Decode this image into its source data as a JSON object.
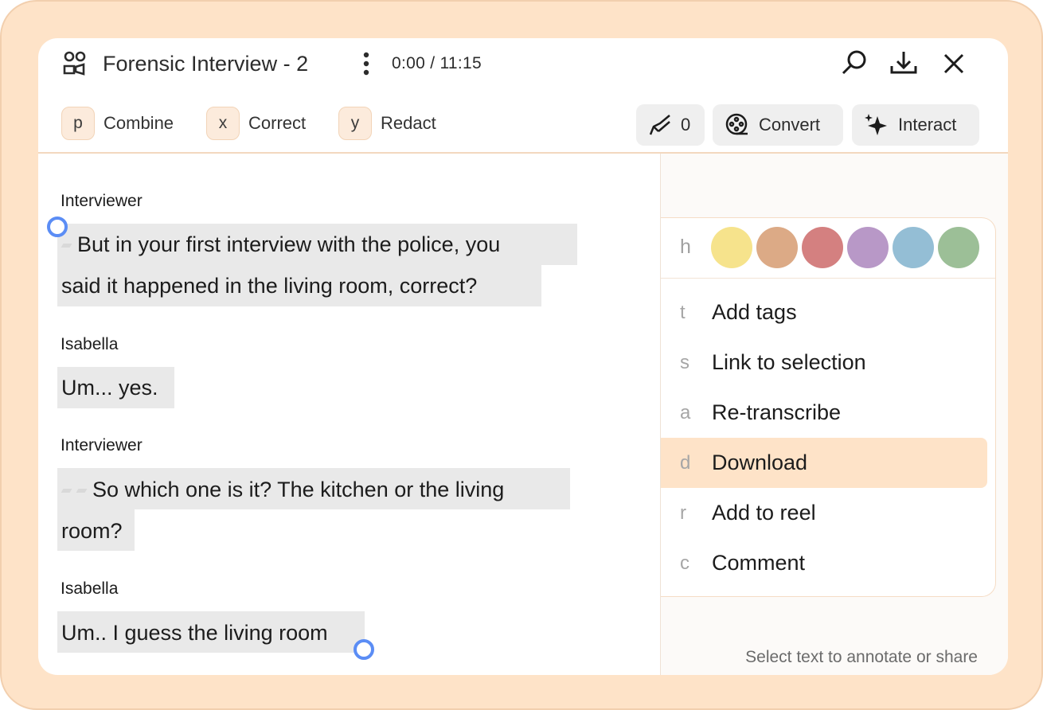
{
  "header": {
    "title": "Forensic Interview - 2",
    "time": "0:00 / 11:15",
    "icons": [
      "people-icon",
      "more-vertical-icon",
      "search-icon",
      "download-icon",
      "close-icon"
    ]
  },
  "shortcuts": [
    {
      "key": "p",
      "label": "Combine"
    },
    {
      "key": "x",
      "label": "Correct"
    },
    {
      "key": "y",
      "label": "Redact"
    }
  ],
  "actions": {
    "highlight_count": "0",
    "convert_label": "Convert",
    "interact_label": "Interact"
  },
  "transcript": [
    {
      "speaker": "Interviewer",
      "lines": [
        "But in your first interview with the police, you",
        "said it happened in the living room, correct?"
      ]
    },
    {
      "speaker": "Isabella",
      "lines": [
        "Um... yes."
      ]
    },
    {
      "speaker": "Interviewer",
      "lines": [
        "So which one is it? The kitchen or the living",
        "room?"
      ]
    },
    {
      "speaker": "Isabella",
      "lines": [
        "Um.. I guess the living room"
      ]
    }
  ],
  "context_menu": {
    "color_key": "h",
    "colors": [
      "#f6e38c",
      "#dcaa86",
      "#d48080",
      "#b898c7",
      "#94bed5",
      "#9cbf97"
    ],
    "items": [
      {
        "key": "t",
        "label": "Add tags"
      },
      {
        "key": "s",
        "label": "Link to selection"
      },
      {
        "key": "a",
        "label": "Re-transcribe"
      },
      {
        "key": "d",
        "label": "Download"
      },
      {
        "key": "r",
        "label": "Add to reel"
      },
      {
        "key": "c",
        "label": "Comment"
      }
    ],
    "active_item": "Download"
  },
  "panel_hint": "Select text to annotate or share",
  "accent": {
    "selection_handle": "#5b8df5",
    "frame": "#fee3c8",
    "highlight": "#e9e9e9"
  }
}
